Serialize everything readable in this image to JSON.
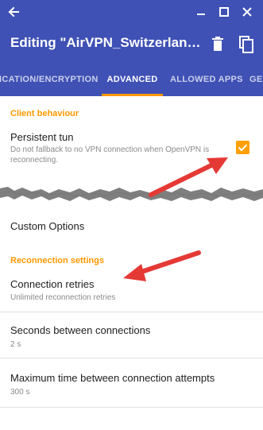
{
  "window": {
    "back_icon": "back-arrow-icon",
    "controls": [
      "minimize-icon",
      "maximize-icon",
      "close-icon"
    ]
  },
  "toolbar": {
    "title": "Editing \"AirVPN_Switzerland_U...",
    "delete_icon": "trash-icon",
    "copy_icon": "copy-icon"
  },
  "tabs": [
    {
      "label": "TICATION/ENCRYPTION",
      "active": false
    },
    {
      "label": "ADVANCED",
      "active": true
    },
    {
      "label": "ALLOWED APPS",
      "active": false
    },
    {
      "label": "GE",
      "active": false
    }
  ],
  "sections": {
    "client_behaviour": "Client behaviour",
    "reconnection_settings": "Reconnection settings"
  },
  "prefs": {
    "persistent_tun": {
      "title": "Persistent tun",
      "summary": "Do not fallback to no VPN connection when OpenVPN is reconnecting.",
      "checked": true
    },
    "custom_options": {
      "title": "Custom Options"
    },
    "connection_retries": {
      "title": "Connection retries",
      "summary": "Unlimited reconnection retries"
    },
    "seconds_between": {
      "title": "Seconds between connections",
      "summary": "2 s"
    },
    "max_time": {
      "title": "Maximum time between connection attempts",
      "summary": "300 s"
    }
  },
  "colors": {
    "primary": "#3F51B5",
    "accent": "#FF9800",
    "checkbox": "#FFA000",
    "annotation_arrow": "#E53935"
  }
}
